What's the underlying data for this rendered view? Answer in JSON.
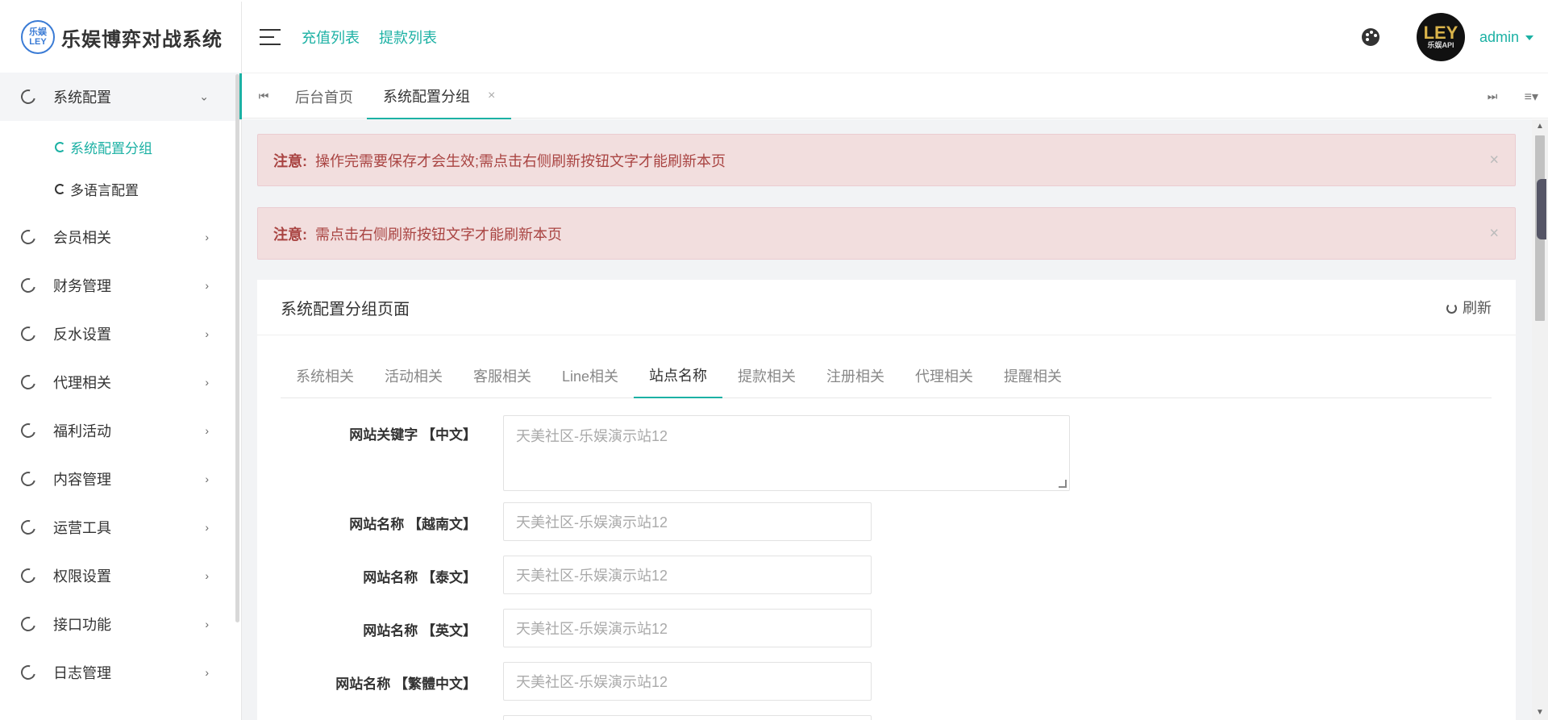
{
  "app": {
    "logo_badge": "乐娱 LEY",
    "title": "乐娱博弈对战系统"
  },
  "header": {
    "links": [
      "充值列表",
      "提款列表"
    ],
    "avatar_text": "LEY",
    "avatar_sub": "乐娱API",
    "user": "admin"
  },
  "sidebar": {
    "items": [
      {
        "label": "系统配置",
        "open": true
      },
      {
        "label": "会员相关"
      },
      {
        "label": "财务管理"
      },
      {
        "label": "反水设置"
      },
      {
        "label": "代理相关"
      },
      {
        "label": "福利活动"
      },
      {
        "label": "内容管理"
      },
      {
        "label": "运营工具"
      },
      {
        "label": "权限设置"
      },
      {
        "label": "接口功能"
      },
      {
        "label": "日志管理"
      }
    ],
    "submenu": [
      {
        "label": "系统配置分组",
        "active": true
      },
      {
        "label": "多语言配置"
      }
    ]
  },
  "tabbar": {
    "home": "后台首页",
    "current": "系统配置分组",
    "close": "×"
  },
  "alerts": [
    {
      "prefix": "注意:",
      "text": "操作完需要保存才会生效;需点击右侧刷新按钮文字才能刷新本页"
    },
    {
      "prefix": "注意:",
      "text": "需点击右侧刷新按钮文字才能刷新本页"
    }
  ],
  "card": {
    "title": "系统配置分组页面",
    "refresh": "刷新",
    "tabs": [
      "系统相关",
      "活动相关",
      "客服相关",
      "Line相关",
      "站点名称",
      "提款相关",
      "注册相关",
      "代理相关",
      "提醒相关"
    ],
    "active_tab": "站点名称",
    "fields": [
      {
        "label": "网站关键字 【中文】",
        "value": "天美社区-乐娱演示站12",
        "type": "textarea"
      },
      {
        "label": "网站名称 【越南文】",
        "value": "天美社区-乐娱演示站12"
      },
      {
        "label": "网站名称 【泰文】",
        "value": "天美社区-乐娱演示站12"
      },
      {
        "label": "网站名称 【英文】",
        "value": "天美社区-乐娱演示站12"
      },
      {
        "label": "网站名称 【繁體中文】",
        "value": "天美社区-乐娱演示站12"
      }
    ]
  },
  "colors": {
    "accent": "#1cb1a4",
    "alert_bg": "#f2dede",
    "alert_text": "#a94442"
  }
}
